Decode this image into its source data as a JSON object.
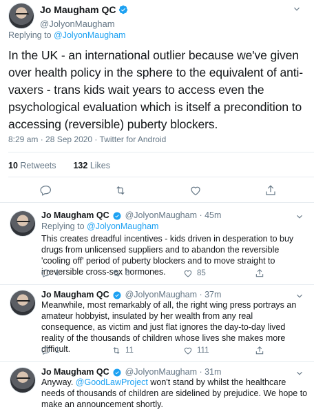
{
  "main_tweet": {
    "author": {
      "display_name": "Jo Maugham QC",
      "handle": "@JolyonMaugham",
      "verified": true
    },
    "replying_to_prefix": "Replying to",
    "replying_to_handle": "@JolyonMaugham",
    "text": "In the UK - an international outlier because we've given over health policy in the sphere to the equivalent of anti-vaxers - trans kids wait years to access even the psychological evaluation which is itself a precondition to accessing (reversible) puberty blockers.",
    "meta": "8:29 am · 28 Sep 2020 · Twitter for Android",
    "stats": {
      "retweets_count": "10",
      "retweets_label": "Retweets",
      "likes_count": "132",
      "likes_label": "Likes"
    },
    "action_icons": [
      "reply-icon",
      "retweet-icon",
      "like-icon",
      "share-icon"
    ]
  },
  "replies": [
    {
      "display_name": "Jo Maugham QC",
      "handle_time": "@JolyonMaugham · 45m",
      "replying_to_prefix": "Replying to",
      "replying_to_handle": "@JolyonMaugham",
      "text": "This creates dreadful incentives - kids driven in desperation to buy drugs from unlicensed suppliers and to abandon the reversible 'cooling off' period of puberty blockers and to move straight to irreversible cross-sex hormones.",
      "counts": {
        "replies": "1",
        "retweets": "6",
        "likes": "85"
      }
    },
    {
      "display_name": "Jo Maugham QC",
      "handle_time": "@JolyonMaugham · 37m",
      "text": "Meanwhile, most remarkably of all, the right wing press portrays an amateur hobbyist, insulated by her wealth from any real consequence, as victim and just flat ignores the day-to-day lived reality of the thousands of children whose lives she makes more difficult.",
      "counts": {
        "replies": "1",
        "retweets": "11",
        "likes": "111"
      }
    },
    {
      "display_name": "Jo Maugham QC",
      "handle_time": "@JolyonMaugham · 31m",
      "text_before_link": "Anyway. ",
      "text_link": "@GoodLawProject",
      "text_after_link": " won't stand by whilst the healthcare needs of thousands of children are sidelined by prejudice. We hope to make an announcement shortly."
    }
  ],
  "colors": {
    "accent": "#1da1f2",
    "secondary_text": "#657786",
    "primary_text": "#14171a",
    "divider": "#e6ecf0"
  }
}
